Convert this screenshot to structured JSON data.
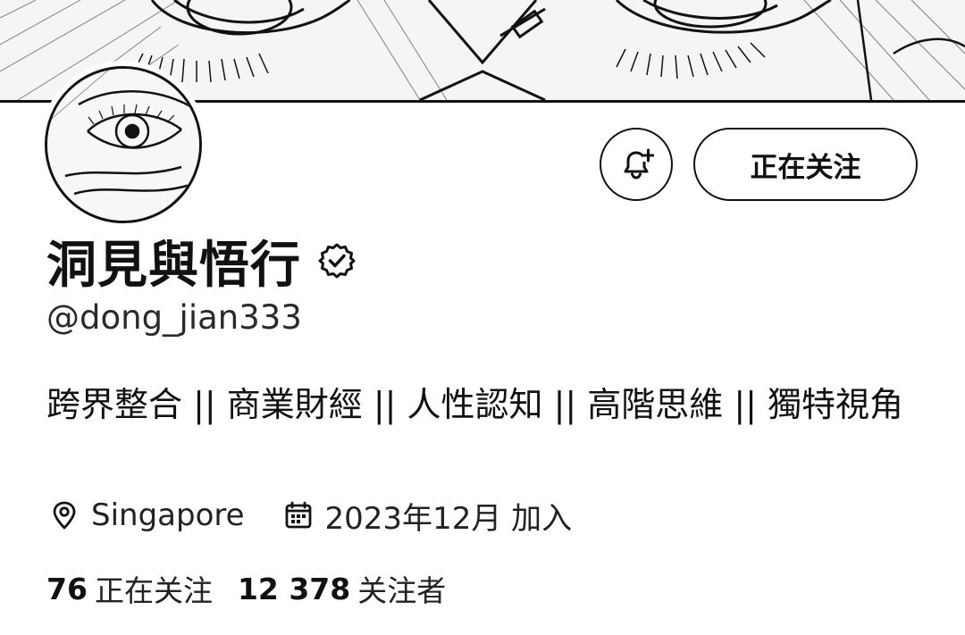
{
  "profile": {
    "display_name": "洞見與悟行",
    "handle": "@dong_jian333",
    "bio": "跨界整合 || 商業財經 || 人性認知 || 高階思維 || 獨特視角",
    "location": "Singapore",
    "joined": "2023年12月 加入"
  },
  "actions": {
    "follow_label": "正在关注",
    "bell_icon": "bell-plus-icon"
  },
  "stats": {
    "following_count": "76",
    "following_label": "正在关注",
    "followers_count": "12 378",
    "followers_label": "关注者"
  },
  "icons": {
    "verified": "verified-badge-icon",
    "location": "map-pin-icon",
    "calendar": "calendar-icon"
  }
}
